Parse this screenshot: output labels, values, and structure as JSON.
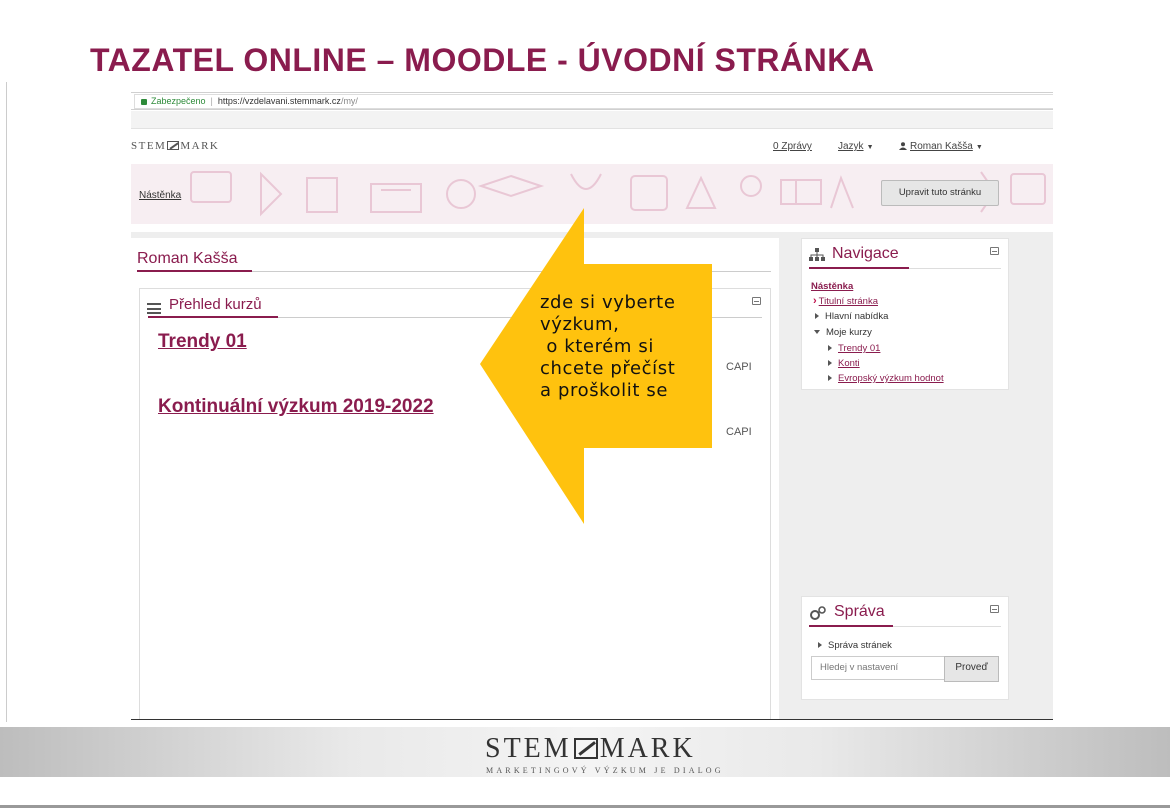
{
  "slide": {
    "title": "TAZATEL ONLINE – MOODLE - ÚVODNÍ STRÁNKA"
  },
  "browser": {
    "secure_label": "Zabezpečeno",
    "url_host": "https://vzdelavani.stemmark.cz",
    "url_path": "/my/"
  },
  "site": {
    "brand_left": "STEM",
    "brand_right": "MARK",
    "messages_link": "0 Zprávy",
    "language_menu": "Jazyk",
    "user_menu": "Roman Kašša",
    "breadcrumb": "Nástěnka",
    "edit_page_button": "Upravit tuto stránku"
  },
  "main": {
    "user_heading": "Roman Kašša",
    "course_overview_title": "Přehled kurzů",
    "courses": [
      {
        "name": "Trendy 01",
        "tag": "CAPI"
      },
      {
        "name": "Kontinuální výzkum 2019-2022",
        "tag": "CAPI"
      }
    ]
  },
  "navigation_block": {
    "title": "Navigace",
    "dashboard": "Nástěnka",
    "home": "Titulní stránka",
    "main_menu": "Hlavní nabídka",
    "my_courses": "Moje kurzy",
    "course_items": [
      "Trendy 01",
      "Konti",
      "Evropský výzkum hodnot"
    ]
  },
  "admin_block": {
    "title": "Správa",
    "site_admin": "Správa stránek",
    "search_placeholder": "Hledej v nastavení",
    "search_button": "Proveď"
  },
  "callout": {
    "text": "zde si vyberte\nvýzkum,\n o kterém si\nchcete přečíst\na proškolit se",
    "color": "#ffc20e"
  },
  "footer": {
    "logo_left": "STEM",
    "logo_right": "MARK",
    "tagline": "MARKETINGOVÝ VÝZKUM JE DIALOG"
  }
}
